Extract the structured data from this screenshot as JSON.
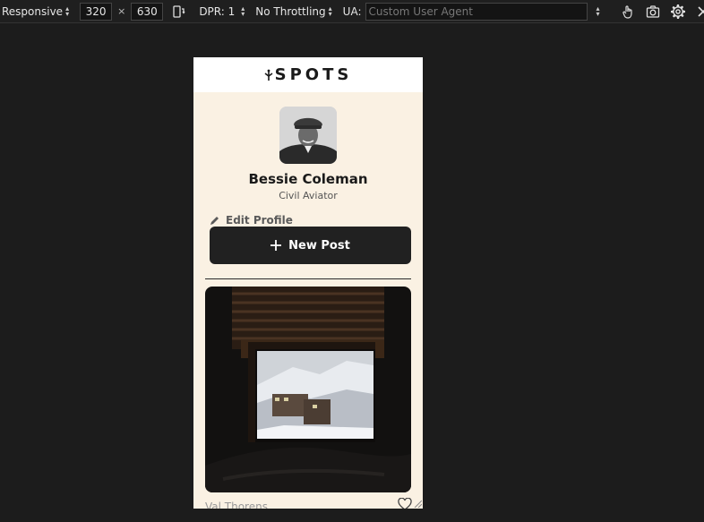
{
  "toolbar": {
    "device": "Responsive",
    "width": "320",
    "times": "×",
    "height": "630",
    "dpr": "DPR: 1",
    "throttling": "No Throttling",
    "ua_label": "UA:",
    "ua_placeholder": "Custom User Agent"
  },
  "app": {
    "logo": "SPOTS",
    "profile": {
      "name": "Bessie Coleman",
      "role": "Civil Aviator",
      "edit_label": "Edit Profile",
      "new_post_label": "New Post"
    },
    "cards": [
      {
        "title": "Val Thorens"
      }
    ]
  },
  "colors": {
    "page_bg": "#faf1e3",
    "button_bg": "#212121",
    "devtools_bg": "#1c1c1c"
  }
}
